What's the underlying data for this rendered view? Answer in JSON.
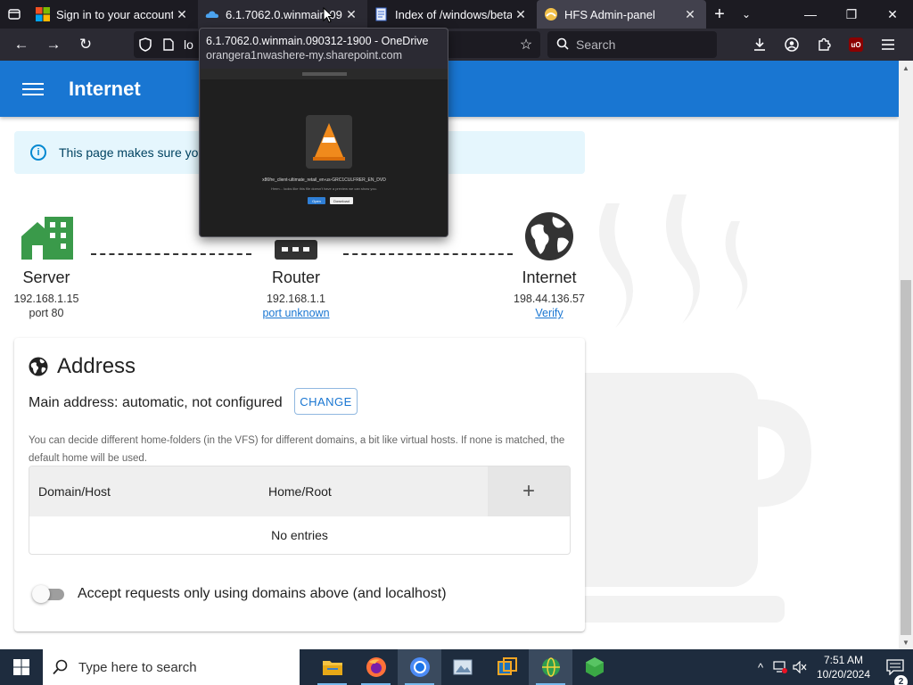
{
  "browser": {
    "tabs": [
      {
        "title": "Sign in to your account",
        "icon": "microsoft-icon",
        "state": "normal"
      },
      {
        "title": "6.1.7062.0.winmain.0903",
        "icon": "onedrive-icon",
        "state": "hovered"
      },
      {
        "title": "Index of /windows/beta/",
        "icon": "document-icon",
        "state": "normal"
      },
      {
        "title": "HFS Admin-panel",
        "icon": "hfs-icon",
        "state": "active"
      }
    ],
    "url_text": "lo",
    "search_placeholder": "Search",
    "ublock_label": "uO",
    "tab_preview": {
      "title": "6.1.7062.0.winmain.090312-1900 - OneDrive",
      "url": "orangera1nwashere-my.sharepoint.com",
      "file_name": "x86fre_client-ultimate_retail_en-us-GRC1CULFRER_EN_DVD",
      "sub_text": "Hmm... looks like this file doesn't have a preview we can show you.",
      "open_label": "Open",
      "download_label": "Download"
    }
  },
  "app": {
    "title": "Internet",
    "alert": "This page makes sure you"
  },
  "network": {
    "server": {
      "label": "Server",
      "ip": "192.168.1.15",
      "port": "port 80"
    },
    "router": {
      "label": "Router",
      "ip": "192.168.1.1",
      "port_link": "port unknown"
    },
    "internet": {
      "label": "Internet",
      "ip": "198.44.136.57",
      "verify_link": "Verify"
    }
  },
  "address": {
    "title": "Address",
    "main_address": "Main address: automatic, not configured",
    "change_label": "CHANGE",
    "note": "You can decide different home-folders (in the VFS) for different domains, a bit like virtual hosts. If none is matched, the default home will be used.",
    "columns": [
      "Domain/Host",
      "Home/Root"
    ],
    "add_label": "+",
    "empty_text": "No entries",
    "switch_label": "Accept requests only using domains above (and localhost)",
    "switch_on": false
  },
  "taskbar": {
    "search_placeholder": "Type here to search",
    "time": "7:51 AM",
    "date": "10/20/2024",
    "notification_count": "2"
  },
  "colors": {
    "app_bar": "#1976d2",
    "alert_bg": "#e5f6fd",
    "link": "#1976d2",
    "browser_dark": "#1c1b22",
    "taskbar": "#1e2c3e"
  }
}
